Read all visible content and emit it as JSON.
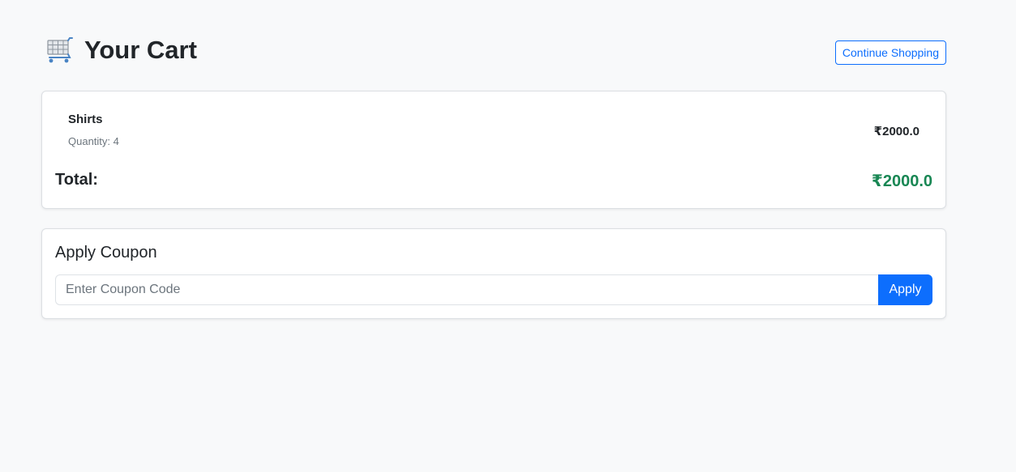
{
  "header": {
    "title": "Your Cart",
    "icon": "shopping-cart-icon",
    "continue_label": "Continue Shopping"
  },
  "cart": {
    "items": [
      {
        "name": "Shirts",
        "quantity_text": "Quantity: 4",
        "price": "₹2000.0"
      }
    ],
    "total_label": "Total:",
    "total_value": "₹2000.0"
  },
  "coupon": {
    "title": "Apply Coupon",
    "placeholder": "Enter Coupon Code",
    "value": "",
    "apply_label": "Apply"
  },
  "colors": {
    "primary": "#0d6efd",
    "success": "#198754",
    "background": "#f8f9fa"
  }
}
